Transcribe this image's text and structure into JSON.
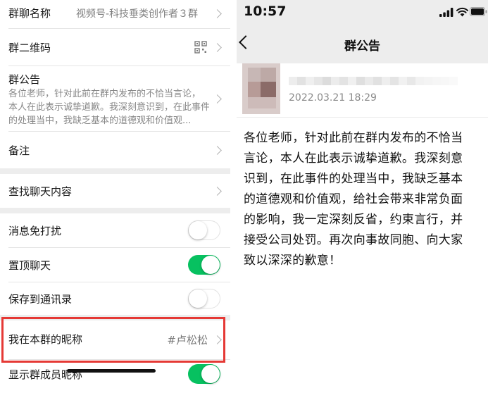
{
  "left": {
    "group_name": {
      "label": "群聊名称",
      "value": "视频号-科技垂类创作者３群"
    },
    "qr": {
      "label": "群二维码"
    },
    "notice": {
      "label": "群公告",
      "preview_lines": [
        "各位老师，针对此前在群内发布的不恰当言论，",
        "本人在此表示诚挚道歉。我深刻意识到，在此事件",
        "的处理当中，我缺乏基本的道德观和价值观..."
      ]
    },
    "remark": {
      "label": "备注"
    },
    "search_history": {
      "label": "查找聊天内容"
    },
    "mute": {
      "label": "消息免打扰",
      "on": false
    },
    "sticky": {
      "label": "置顶聊天",
      "on": true
    },
    "save_contacts": {
      "label": "保存到通讯录",
      "on": false
    },
    "my_nickname": {
      "label": "我在本群的昵称",
      "value": "#卢松松"
    },
    "show_nicknames": {
      "label": "显示群成员昵称",
      "on": true
    },
    "colors": {
      "accent": "#07c160",
      "highlight": "#e53935",
      "gap": "#ededed"
    }
  },
  "right": {
    "status_time": "10:57",
    "status_icons": [
      "signal-icon",
      "wifi-icon",
      "battery-icon"
    ],
    "title": "群公告",
    "date": "2022.03.21  18:29",
    "content_lines": [
      "各位老师，针对此前在群内发布的不恰当",
      "言论，本人在此表示诚挚道歉。我深刻意",
      "识到，在此事件的处理当中，我缺乏基本",
      "的道德观和价值观，给社会带来非常负面",
      "的影响，我一定深刻反省，约束言行，并",
      "接受公司处罚。再次向事故同胞、向大家",
      "致以深深的歉意！"
    ]
  }
}
